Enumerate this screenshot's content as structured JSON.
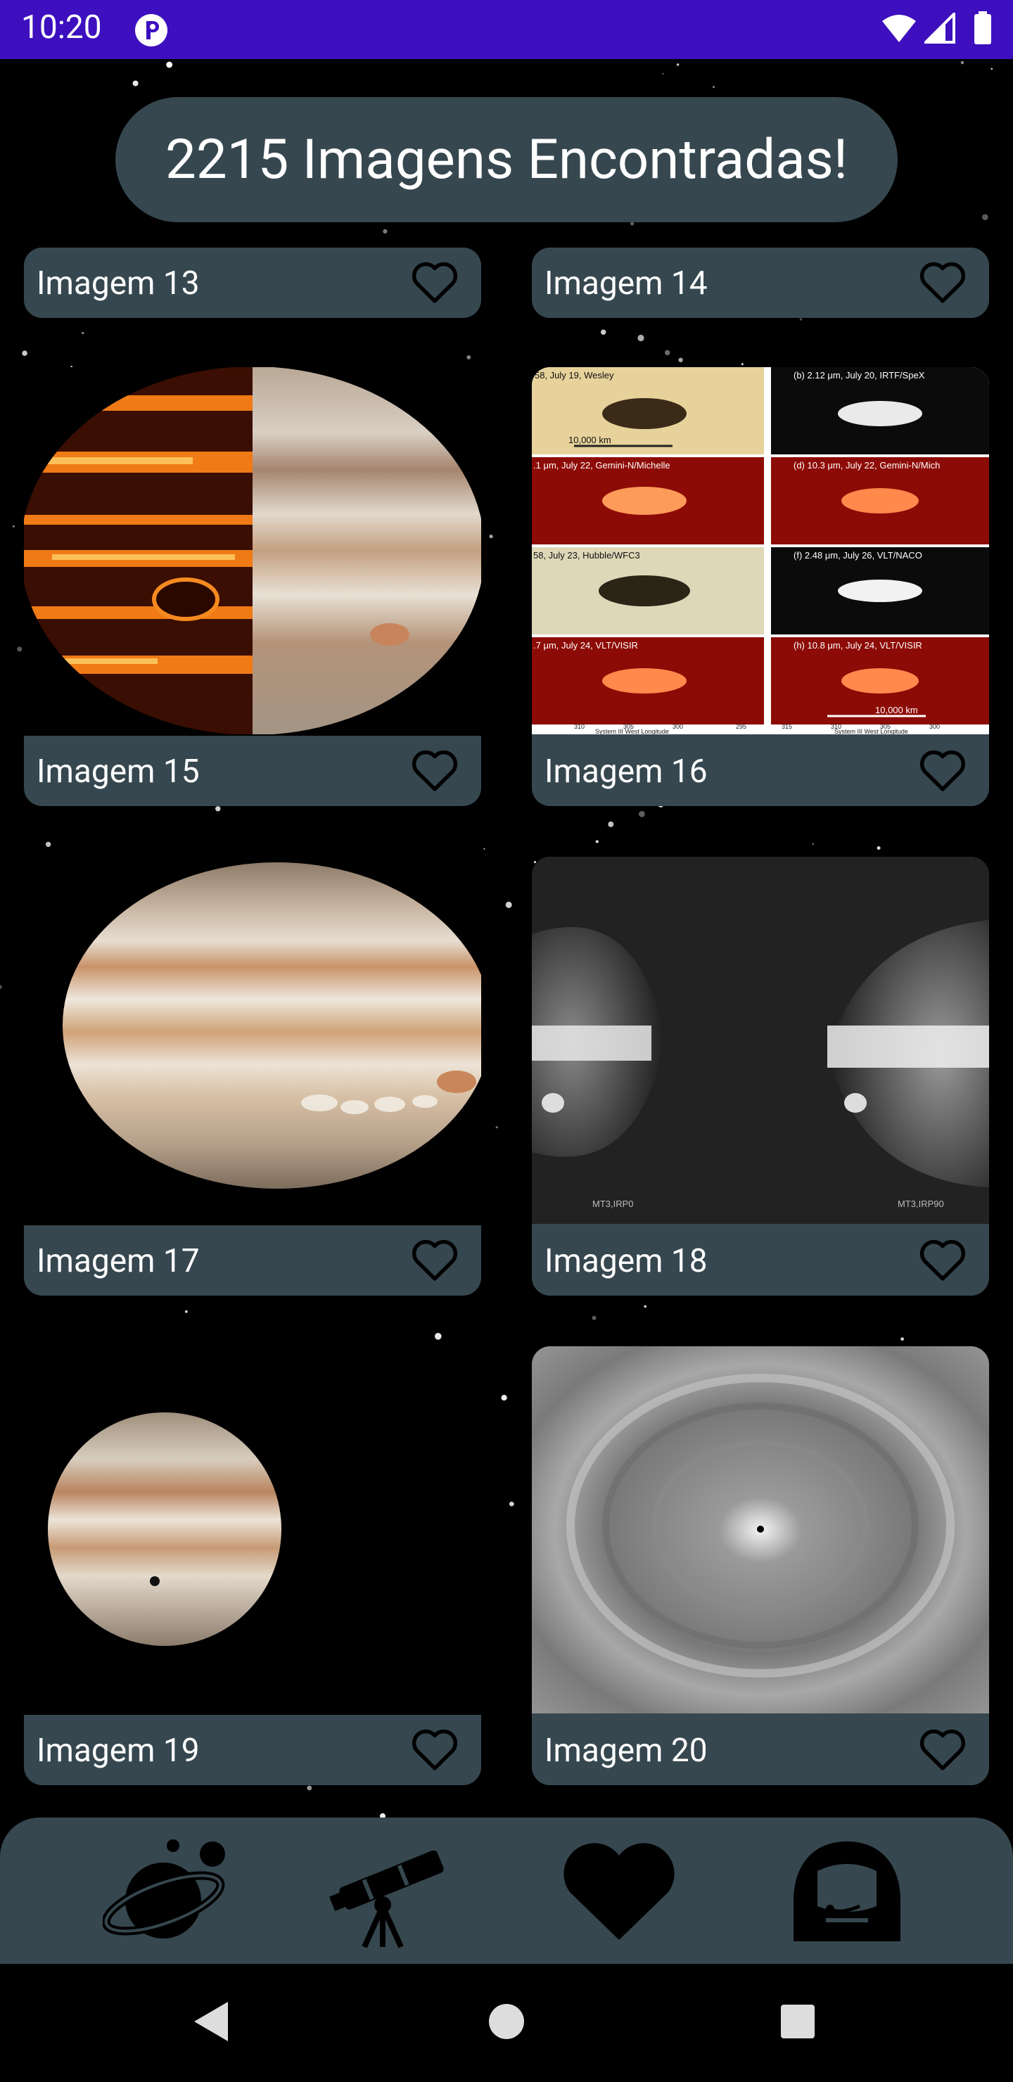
{
  "status_bar": {
    "time": "10:20",
    "app_icon": "pi-app-icon",
    "wifi_icon": "wifi-icon",
    "signal_icon": "cell-signal-icon",
    "battery_icon": "battery-icon"
  },
  "header": {
    "count_text": "2215 Imagens Encontradas!"
  },
  "cards": [
    {
      "label": "Imagem 13",
      "image": "jupiter-image-13"
    },
    {
      "label": "Imagem 14",
      "image": "jupiter-image-14"
    },
    {
      "label": "Imagem 15",
      "image": "jupiter-infrared-visible-split"
    },
    {
      "label": "Imagem 16",
      "image": "jupiter-multi-panel-observations",
      "panel_texts": [
        "",
        "(b) 2.12 μm, July 20, IRTF/SpeX",
        ".1 μm, July 22, Gemini-N/Michelle",
        "(d) 10.3 μm, July 22, Gemini-N/Mich",
        "58, July 23, Hubble/WFC3",
        "(f) 2.48 μm, July 26, VLT/NACO",
        ".7 μm, July 24, VLT/VISIR",
        "(h) 10.8 μm, July 24, VLT/VISIR"
      ],
      "panel_first_texts": [
        "58, July 19, Wesley",
        "10,000 km",
        "10,000 km"
      ],
      "axis_texts": [
        "310",
        "305",
        "300",
        "295",
        "System III West Longitude",
        "315",
        "310",
        "305",
        "300",
        "System III West Longitude"
      ]
    },
    {
      "label": "Imagem 17",
      "image": "jupiter-hubble-visible"
    },
    {
      "label": "Imagem 18",
      "image": "jupiter-grayscale-pair",
      "captions": [
        "MT3,IRP0",
        "MT3,IRP90"
      ]
    },
    {
      "label": "Imagem 19",
      "image": "jupiter-with-shadow"
    },
    {
      "label": "Imagem 20",
      "image": "jupiter-pole-grayscale"
    }
  ],
  "bottom_nav": [
    {
      "name": "planets-nav",
      "icon": "planet-icon"
    },
    {
      "name": "telescope-nav",
      "icon": "telescope-icon"
    },
    {
      "name": "favorites-nav",
      "icon": "heart-icon"
    },
    {
      "name": "astronaut-nav",
      "icon": "astronaut-icon"
    }
  ],
  "system_nav": {
    "back": "back-icon",
    "home": "home-icon",
    "recents": "recents-icon"
  },
  "colors": {
    "status_bar": "#3d0fbf",
    "card_label_bg": "#36474f",
    "nav_bg": "#36474f",
    "background": "#000000"
  }
}
